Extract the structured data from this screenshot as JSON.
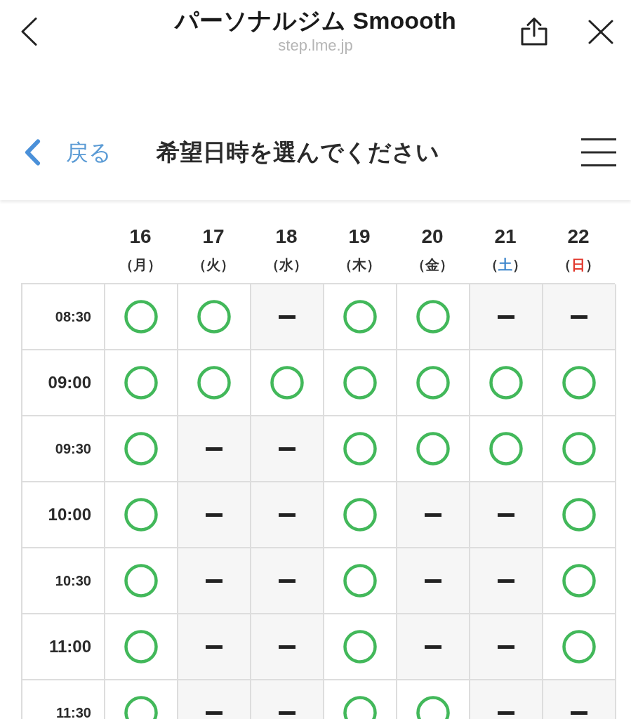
{
  "browser_bar": {
    "title": "パーソナルジム Smoooth",
    "url": "step.lme.jp"
  },
  "page_header": {
    "back_label": "戻る",
    "title": "希望日時を選んでください"
  },
  "schedule": {
    "days": [
      {
        "date": "16",
        "open": "（",
        "weekday": "月",
        "close": "）",
        "color": "#333333"
      },
      {
        "date": "17",
        "open": "（",
        "weekday": "火",
        "close": "）",
        "color": "#333333"
      },
      {
        "date": "18",
        "open": "（",
        "weekday": "水",
        "close": "）",
        "color": "#333333"
      },
      {
        "date": "19",
        "open": "（",
        "weekday": "木",
        "close": "）",
        "color": "#333333"
      },
      {
        "date": "20",
        "open": "（",
        "weekday": "金",
        "close": "）",
        "color": "#333333"
      },
      {
        "date": "21",
        "open": "（",
        "weekday": "土",
        "close": "）",
        "color": "#3d86cc"
      },
      {
        "date": "22",
        "open": "（",
        "weekday": "日",
        "close": "）",
        "color": "#e2372c"
      }
    ],
    "rows": [
      {
        "time": "08:30",
        "kind": "half-hour",
        "cells": [
          {
            "available": true
          },
          {
            "available": true
          },
          {
            "available": false
          },
          {
            "available": true
          },
          {
            "available": true
          },
          {
            "available": false
          },
          {
            "available": false
          }
        ]
      },
      {
        "time": "09:00",
        "kind": "hour",
        "cells": [
          {
            "available": true
          },
          {
            "available": true
          },
          {
            "available": true
          },
          {
            "available": true
          },
          {
            "available": true
          },
          {
            "available": true
          },
          {
            "available": true
          }
        ]
      },
      {
        "time": "09:30",
        "kind": "half-hour",
        "cells": [
          {
            "available": true
          },
          {
            "available": false
          },
          {
            "available": false
          },
          {
            "available": true
          },
          {
            "available": true
          },
          {
            "available": true
          },
          {
            "available": true
          }
        ]
      },
      {
        "time": "10:00",
        "kind": "hour",
        "cells": [
          {
            "available": true
          },
          {
            "available": false
          },
          {
            "available": false
          },
          {
            "available": true
          },
          {
            "available": false
          },
          {
            "available": false
          },
          {
            "available": true
          }
        ]
      },
      {
        "time": "10:30",
        "kind": "half-hour",
        "cells": [
          {
            "available": true
          },
          {
            "available": false
          },
          {
            "available": false
          },
          {
            "available": true
          },
          {
            "available": false
          },
          {
            "available": false
          },
          {
            "available": true
          }
        ]
      },
      {
        "time": "11:00",
        "kind": "hour",
        "cells": [
          {
            "available": true
          },
          {
            "available": false
          },
          {
            "available": false
          },
          {
            "available": true
          },
          {
            "available": false
          },
          {
            "available": false
          },
          {
            "available": true
          }
        ]
      },
      {
        "time": "11:30",
        "kind": "half-hour",
        "cells": [
          {
            "available": true
          },
          {
            "available": false
          },
          {
            "available": false
          },
          {
            "available": true
          },
          {
            "available": true
          },
          {
            "available": false
          },
          {
            "available": false
          }
        ]
      }
    ]
  }
}
